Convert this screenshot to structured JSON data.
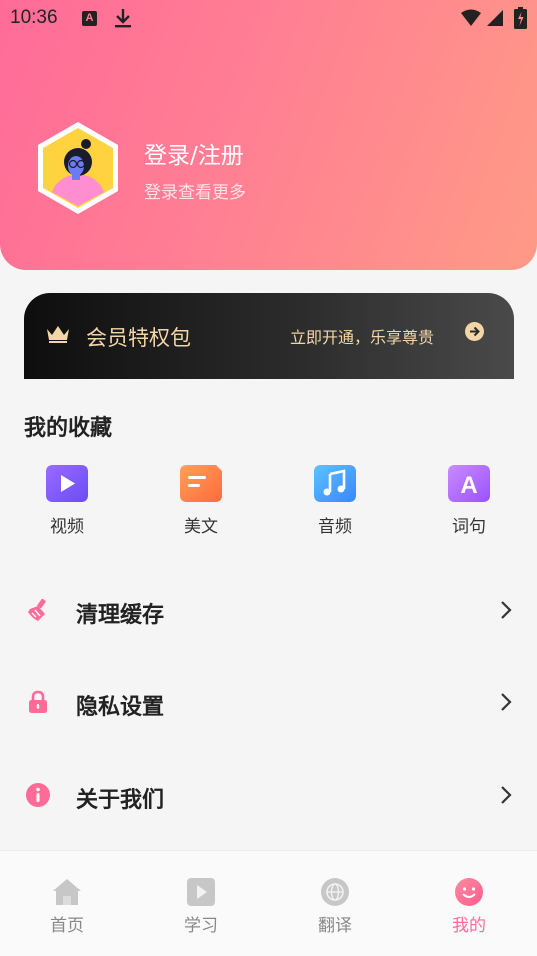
{
  "status_bar": {
    "time": "10:36",
    "a_badge": "A"
  },
  "profile": {
    "title": "登录/注册",
    "subtitle": "登录查看更多"
  },
  "vip": {
    "title": "会员特权包",
    "cta": "立即开通，乐享尊贵"
  },
  "favorites": {
    "title": "我的收藏",
    "items": [
      {
        "label": "视频",
        "icon": "video-play-icon",
        "color": "#7b5cff"
      },
      {
        "label": "美文",
        "icon": "article-icon",
        "color": "#ff7f4a"
      },
      {
        "label": "音频",
        "icon": "music-note-icon",
        "color": "#3fa6ff"
      },
      {
        "label": "词句",
        "icon": "letter-a-icon",
        "color": "#b05cff"
      }
    ]
  },
  "menu": [
    {
      "label": "清理缓存",
      "icon": "broom-icon"
    },
    {
      "label": "隐私设置",
      "icon": "lock-icon"
    },
    {
      "label": "关于我们",
      "icon": "info-icon"
    }
  ],
  "tabs": [
    {
      "label": "首页",
      "icon": "home-icon",
      "active": false
    },
    {
      "label": "学习",
      "icon": "play-square-icon",
      "active": false
    },
    {
      "label": "翻译",
      "icon": "globe-icon",
      "active": false
    },
    {
      "label": "我的",
      "icon": "smiley-icon",
      "active": true
    }
  ],
  "colors": {
    "accent": "#ff6b98",
    "vip_gold": "#f3d6a8",
    "header_start": "#ff6b98",
    "header_end": "#ff9a86"
  }
}
